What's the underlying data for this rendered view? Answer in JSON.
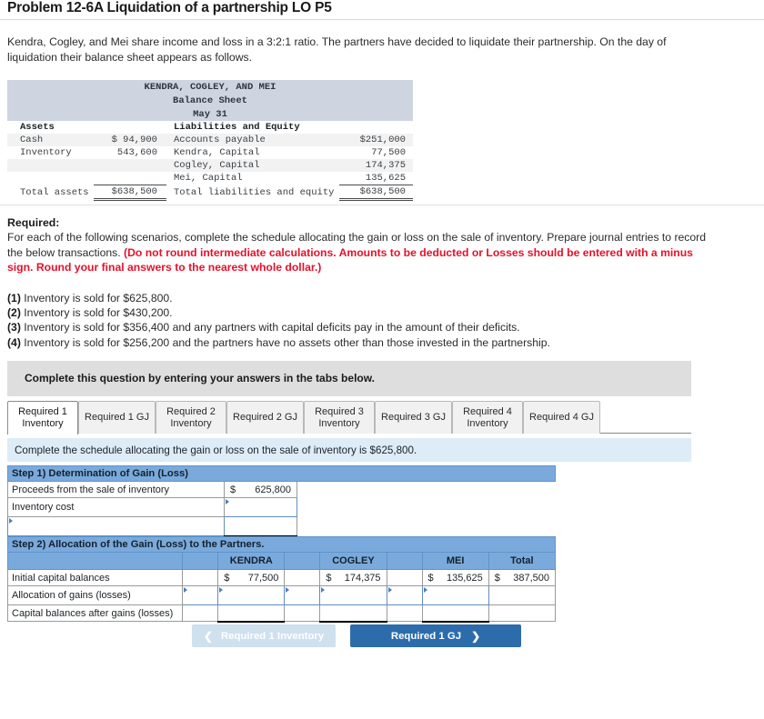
{
  "problem": {
    "title": "Problem 12-6A Liquidation of a partnership LO P5",
    "intro": "Kendra, Cogley, and Mei share income and loss in a 3:2:1 ratio. The partners have decided to liquidate their partnership. On the day of liquidation their balance sheet appears as follows."
  },
  "balance_sheet": {
    "company": "KENDRA, COGLEY, AND MEI",
    "statement": "Balance Sheet",
    "date": "May 31",
    "assets_header": "Assets",
    "equity_header": "Liabilities and Equity",
    "asset_rows": [
      {
        "label": "Cash",
        "amount": "$ 94,900"
      },
      {
        "label": "Inventory",
        "amount": "543,600"
      }
    ],
    "equity_rows": [
      {
        "label": "Accounts payable",
        "amount": "$251,000"
      },
      {
        "label": "Kendra, Capital",
        "amount": "77,500"
      },
      {
        "label": "Cogley, Capital",
        "amount": "174,375"
      },
      {
        "label": "Mei, Capital",
        "amount": "135,625"
      }
    ],
    "total_assets_label": "Total assets",
    "total_assets_amount": "$638,500",
    "total_equity_label": "Total liabilities and equity",
    "total_equity_amount": "$638,500"
  },
  "required": {
    "heading": "Required:",
    "body_plain": "For each of the following scenarios, complete the schedule allocating the gain or loss on the sale of inventory. Prepare journal entries to record the below transactions. ",
    "body_red": "(Do not round intermediate calculations. Amounts to be deducted or Losses should be entered with a minus sign. Round your final answers to the nearest whole dollar.)",
    "scenarios": [
      {
        "num": "(1)",
        "text": " Inventory is sold for $625,800."
      },
      {
        "num": "(2)",
        "text": " Inventory is sold for $430,200."
      },
      {
        "num": "(3)",
        "text": " Inventory is sold for $356,400 and any partners with capital deficits pay in the amount of their deficits."
      },
      {
        "num": "(4)",
        "text": " Inventory is sold for $256,200 and the partners have no assets other than those invested in the partnership."
      }
    ]
  },
  "answer_area": {
    "gray_instruction": "Complete this question by entering your answers in the tabs below.",
    "tabs": [
      {
        "label": "Required 1 Inventory",
        "active": true
      },
      {
        "label": "Required 1 GJ",
        "active": false
      },
      {
        "label": "Required 2 Inventory",
        "active": false
      },
      {
        "label": "Required 2 GJ",
        "active": false
      },
      {
        "label": "Required 3 Inventory",
        "active": false
      },
      {
        "label": "Required 3 GJ",
        "active": false
      },
      {
        "label": "Required 4 Inventory",
        "active": false
      },
      {
        "label": "Required 4 GJ",
        "active": false
      }
    ],
    "blue_instruction": "Complete the schedule allocating the gain or loss on the sale of inventory is $625,800."
  },
  "step1": {
    "title": "Step 1) Determination of Gain (Loss)",
    "rows": [
      {
        "label": "Proceeds from the sale of inventory",
        "value": "625,800",
        "has_dollar": true,
        "editable": false
      },
      {
        "label": "Inventory cost",
        "value": "",
        "has_dollar": false,
        "editable": true
      },
      {
        "label": "",
        "value": "",
        "has_dollar": false,
        "editable": true
      }
    ]
  },
  "step2": {
    "title": "Step 2) Allocation of the Gain (Loss) to the Partners.",
    "columns": [
      "KENDRA",
      "COGLEY",
      "MEI",
      "Total"
    ],
    "rows": [
      {
        "label": "Initial capital balances",
        "editable": false,
        "kendra": "77,500",
        "cogley": "174,375",
        "mei": "135,625",
        "total": "387,500"
      },
      {
        "label": "Allocation of gains (losses)",
        "editable": true,
        "kendra": "",
        "cogley": "",
        "mei": "",
        "total": ""
      },
      {
        "label": "Capital balances after gains (losses)",
        "editable": false,
        "kendra": "",
        "cogley": "",
        "mei": "",
        "total": ""
      }
    ]
  },
  "navigation": {
    "prev_label": "Required 1 Inventory",
    "next_label": "Required 1 GJ",
    "prev_icon": "chevron-left-icon",
    "next_icon": "chevron-right-icon"
  },
  "colors": {
    "header_blue": "#7aaadc",
    "band_blue": "#ddecf7",
    "band_gray": "#dedede",
    "button_blue": "#2d6cab",
    "button_blue_disabled": "#cfe0ef",
    "alert_red": "#e8102a",
    "bs_header_bg": "#ced4e0"
  }
}
